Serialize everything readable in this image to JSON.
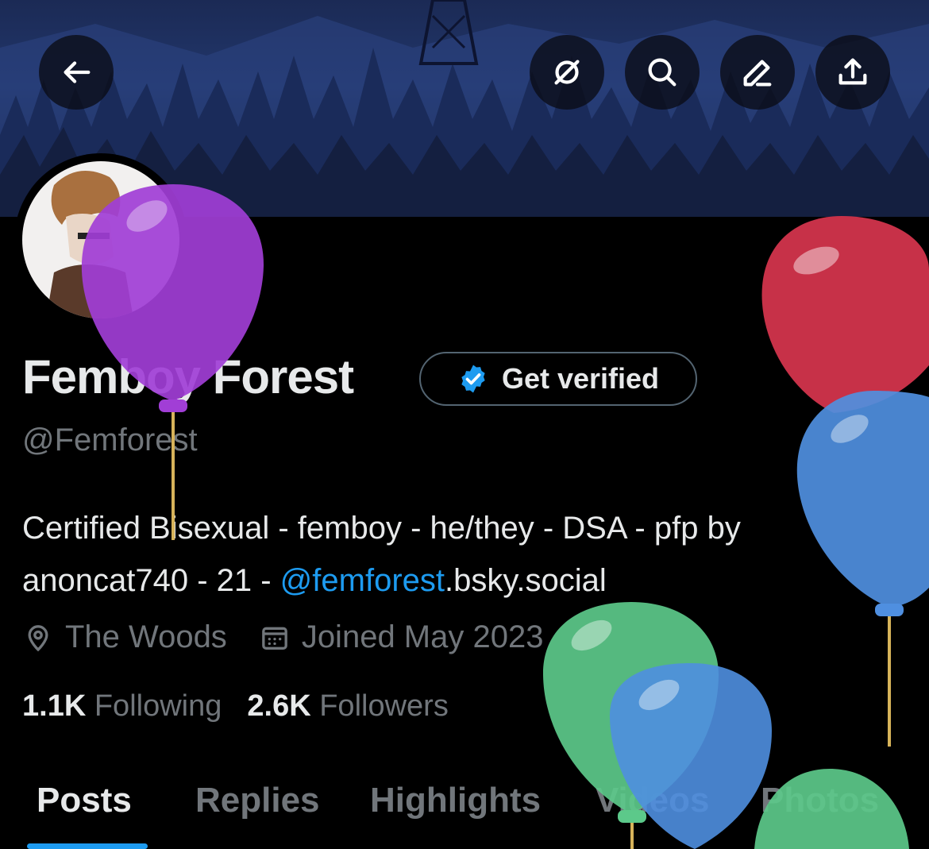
{
  "profile": {
    "name": "Femboy Forest",
    "handle": "@Femforest",
    "verify_label": "Get verified",
    "bio_text": "Certified Bisexual - femboy - he/they - DSA - pfp by anoncat740 - 21 - ",
    "bio_mention": "@femforest",
    "bio_suffix": ".bsky.social",
    "location": "The Woods",
    "joined": "Joined May 2023",
    "following_count": "1.1K",
    "following_label": "Following",
    "followers_count": "2.6K",
    "followers_label": "Followers"
  },
  "header_icons": [
    "back-arrow-icon",
    "grok-icon",
    "search-icon",
    "edit-icon",
    "share-icon"
  ],
  "tabs": [
    {
      "label": "Posts",
      "active": true
    },
    {
      "label": "Replies",
      "active": false
    },
    {
      "label": "Highlights",
      "active": false
    },
    {
      "label": "Videos",
      "active": false
    },
    {
      "label": "Photos",
      "active": false
    }
  ],
  "colors": {
    "accent": "#1d9bf0",
    "background": "#000000",
    "text_primary": "#e7e9ea",
    "text_secondary": "#71767b",
    "balloon_purple": "#a13ed6",
    "balloon_red": "#d2344c",
    "balloon_blue": "#4f8fe0",
    "balloon_green": "#5cc98a"
  }
}
